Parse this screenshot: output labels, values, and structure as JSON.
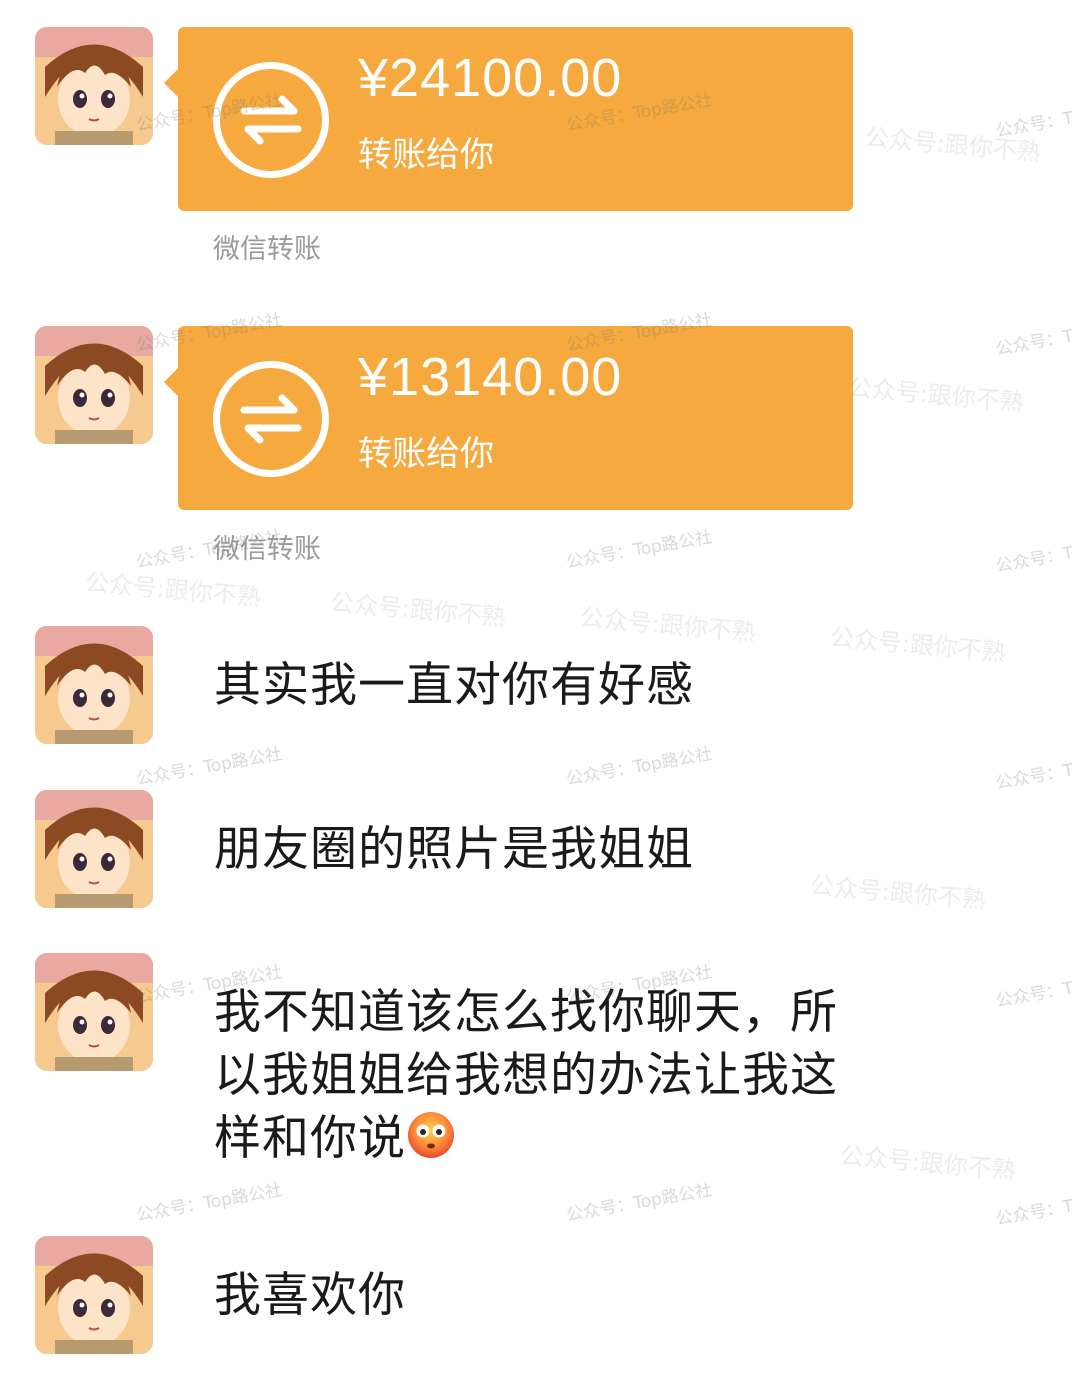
{
  "messages": [
    {
      "kind": "transfer",
      "amount": "¥24100.00",
      "description": "转账给你",
      "label": "微信转账"
    },
    {
      "kind": "transfer",
      "amount": "¥13140.00",
      "description": "转账给你",
      "label": "微信转账"
    },
    {
      "kind": "text",
      "text": "其实我一直对你有好感"
    },
    {
      "kind": "text",
      "text": "朋友圈的照片是我姐姐"
    },
    {
      "kind": "text",
      "line1": "我不知道该怎么找你聊天，所",
      "line2": "以我姐姐给我想的办法让我这",
      "line3": "样和你说",
      "emoji": "flushed-face-icon"
    },
    {
      "kind": "text",
      "text": "我喜欢你"
    }
  ],
  "watermarks": {
    "primary": "公众号：Top路公社",
    "primary_cut": "公众号：T",
    "secondary": "公众号:跟你不熟"
  },
  "colors": {
    "transfer_bg": "#f5a93e",
    "label_gray": "#9a9a9a",
    "text": "#1a1a1a"
  }
}
